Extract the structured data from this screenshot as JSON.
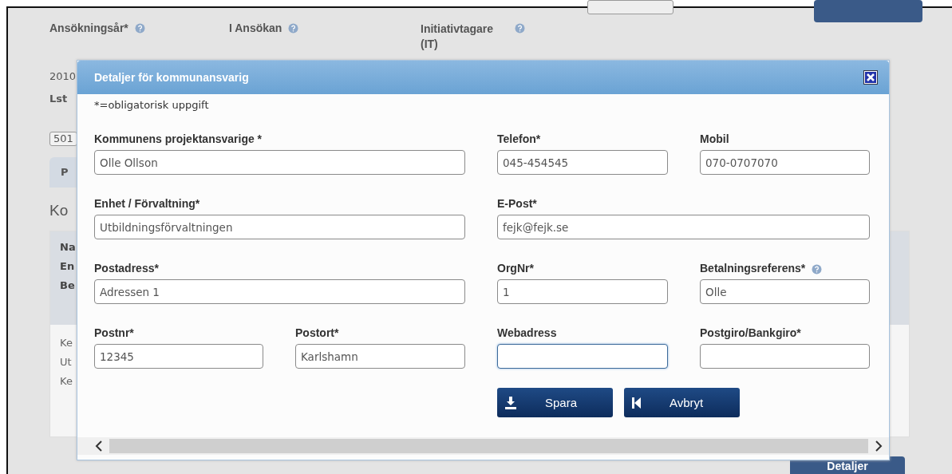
{
  "page": {
    "header_fields": [
      {
        "label": "Ansökningsår*",
        "help": true
      },
      {
        "label": "I Ansökan",
        "help": true
      },
      {
        "label": "Initiativtagare (IT)",
        "help": true
      }
    ],
    "fragments": [
      {
        "kind": "text",
        "text": "2010"
      },
      {
        "kind": "bold",
        "text": "Lst"
      },
      {
        "kind": "field",
        "text": "501"
      },
      {
        "kind": "tab",
        "text": "P"
      },
      {
        "kind": "heading",
        "text": "Ko"
      }
    ],
    "table": {
      "header_lines": [
        "Na",
        "En",
        "Be"
      ],
      "row_lines": [
        "Ke",
        "Ut",
        "Ke"
      ]
    },
    "detail_button": "Detaljer"
  },
  "dialog": {
    "title": "Detaljer för kommunansvarig",
    "note": "*=obligatorisk uppgift",
    "fields": [
      {
        "label": "Kommunens projektansvarige *",
        "value": "Olle Ollson",
        "wide": true
      },
      {
        "label": "Telefon*",
        "value": "045-454545"
      },
      {
        "label": "Mobil",
        "value": "070-0707070"
      },
      {
        "label": "Enhet / Förvaltning*",
        "value": "Utbildningsförvaltningen",
        "wide": true
      },
      {
        "label": "E-Post*",
        "value": "fejk@fejk.se",
        "wide": true
      },
      {
        "label": "Postadress*",
        "value": "Adressen 1",
        "wide": true
      },
      {
        "label": "OrgNr*",
        "value": "1"
      },
      {
        "label": "Betalningsreferens*",
        "value": "Olle",
        "help": true
      },
      {
        "label": "Postnr*",
        "value": "12345"
      },
      {
        "label": "Postort*",
        "value": "Karlshamn"
      },
      {
        "label": "Webadress",
        "focused": true
      },
      {
        "label": "Postgiro/Bankgiro*"
      }
    ],
    "buttons": [
      {
        "label": "Spara",
        "kind": "save"
      },
      {
        "label": "Avbryt",
        "kind": "cancel"
      }
    ]
  }
}
